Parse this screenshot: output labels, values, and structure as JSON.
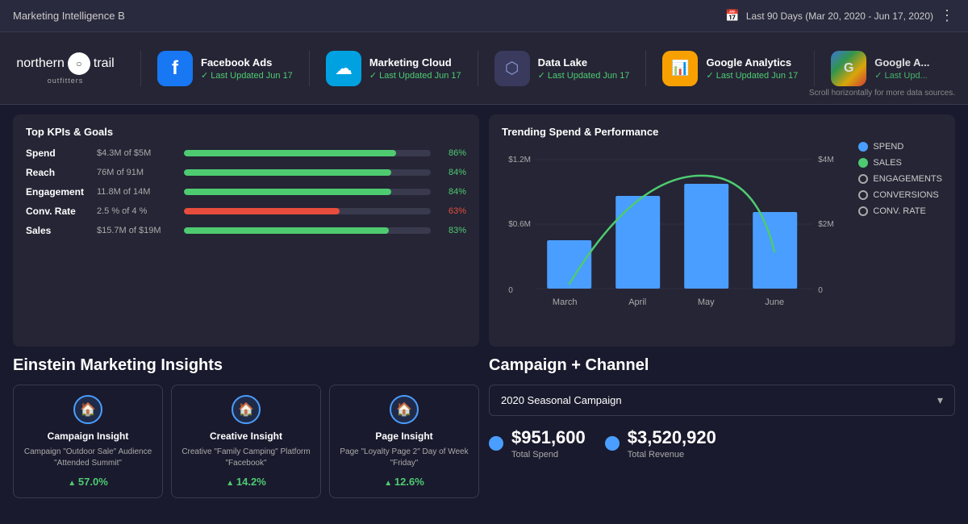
{
  "header": {
    "title": "Marketing Intelligence B",
    "date_range": "Last 90 Days (Mar 20, 2020 - Jun 17, 2020)"
  },
  "logo": {
    "name": "northern ○ trail",
    "sub": "outfitters"
  },
  "sources": [
    {
      "id": "fb",
      "name": "Facebook Ads",
      "updated": "Last Updated Jun 17",
      "icon": "f",
      "class": "fb"
    },
    {
      "id": "mc",
      "name": "Marketing Cloud",
      "updated": "Last Updated Jun 17",
      "icon": "☁",
      "class": "mc"
    },
    {
      "id": "dl",
      "name": "Data Lake",
      "updated": "Last Updated Jun 17",
      "icon": "◈",
      "class": "dl"
    },
    {
      "id": "ga",
      "name": "Google Analytics",
      "updated": "Last Updated Jun 17",
      "icon": "📊",
      "class": "ga"
    },
    {
      "id": "gads",
      "name": "Google A...",
      "updated": "Last Upd...",
      "icon": "G",
      "class": "gads"
    }
  ],
  "scroll_hint": "Scroll horizontally for more data sources.",
  "kpi": {
    "title": "Top KPIs & Goals",
    "rows": [
      {
        "label": "Spend",
        "value": "$4.3M of $5M",
        "pct": 86,
        "color": "green",
        "pct_label": "86%"
      },
      {
        "label": "Reach",
        "value": "76M of 91M",
        "pct": 84,
        "color": "green",
        "pct_label": "84%"
      },
      {
        "label": "Engagement",
        "value": "11.8M of 14M",
        "pct": 84,
        "color": "green",
        "pct_label": "84%"
      },
      {
        "label": "Conv. Rate",
        "value": "2.5 % of 4 %",
        "pct": 63,
        "color": "red",
        "pct_label": "63%"
      },
      {
        "label": "Sales",
        "value": "$15.7M of $19M",
        "pct": 83,
        "color": "green",
        "pct_label": "83%"
      }
    ]
  },
  "trending": {
    "title": "Trending Spend & Performance",
    "months": [
      "March",
      "April",
      "May",
      "June"
    ],
    "bars": [
      35,
      68,
      78,
      52
    ],
    "left_axis": [
      "$1.2M",
      "$0.6M",
      "0"
    ],
    "right_axis": [
      "$4M",
      "$2M",
      "0"
    ],
    "legend": [
      {
        "label": "SPEND",
        "type": "filled-blue"
      },
      {
        "label": "SALES",
        "type": "filled-green"
      },
      {
        "label": "ENGAGEMENTS",
        "type": "outline"
      },
      {
        "label": "CONVERSIONS",
        "type": "outline"
      },
      {
        "label": "CONV. RATE",
        "type": "outline"
      }
    ]
  },
  "einstein": {
    "title": "Einstein Marketing Insights",
    "cards": [
      {
        "type": "Campaign Insight",
        "desc": "Campaign \"Outdoor Sale\" Audience \"Attended Summit\"",
        "pct": "57.0%"
      },
      {
        "type": "Creative Insight",
        "desc": "Creative \"Family Camping\" Platform \"Facebook\"",
        "pct": "14.2%"
      },
      {
        "type": "Page Insight",
        "desc": "Page \"Loyalty Page 2\" Day of Week \"Friday\"",
        "pct": "12.6%"
      }
    ]
  },
  "campaign": {
    "title": "Campaign + Channel",
    "dropdown_value": "2020 Seasonal Campaign",
    "metrics": [
      {
        "label": "Total Spend",
        "amount": "$951,600"
      },
      {
        "label": "Total Revenue",
        "amount": "$3,520,920"
      }
    ]
  }
}
